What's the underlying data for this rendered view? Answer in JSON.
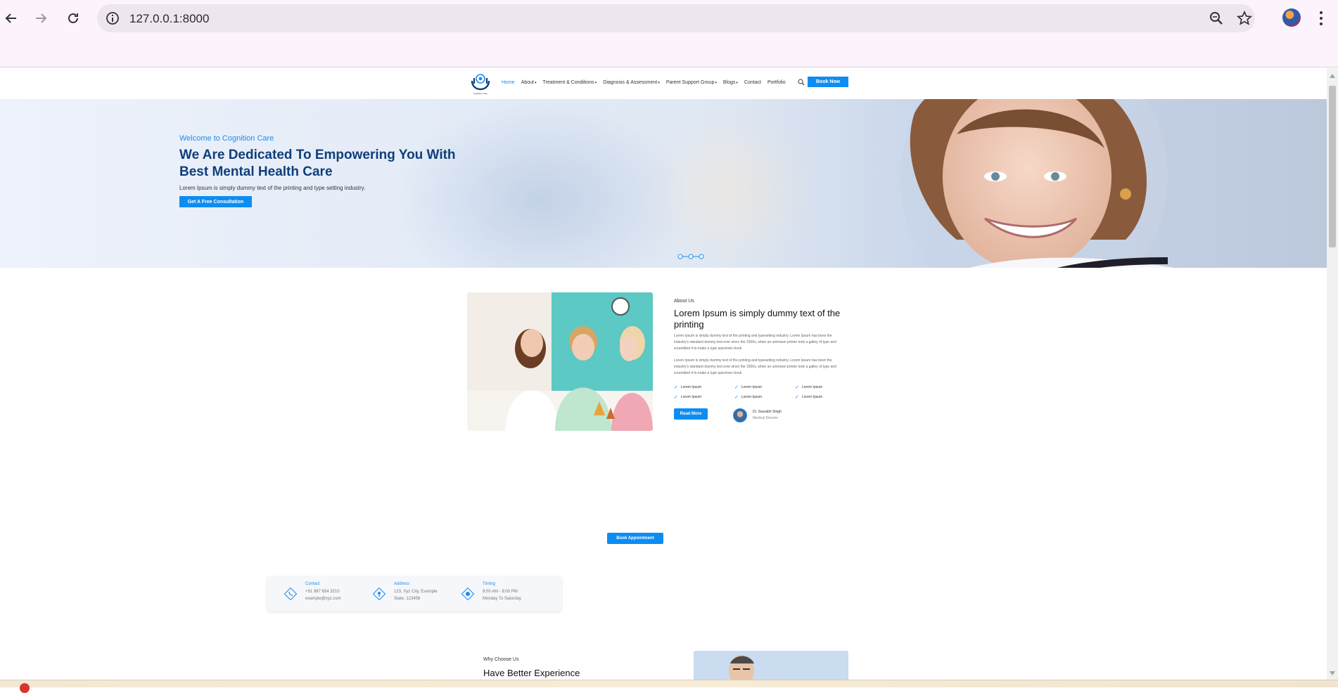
{
  "browser": {
    "url": "127.0.0.1:8000"
  },
  "nav": {
    "menu": [
      {
        "label": "Home",
        "dropdown": false,
        "active": true
      },
      {
        "label": "About",
        "dropdown": true
      },
      {
        "label": "Treatment & Conditions",
        "dropdown": true
      },
      {
        "label": "Diagnosis & Assessment",
        "dropdown": true
      },
      {
        "label": "Parent Support Group",
        "dropdown": true
      },
      {
        "label": "Blogs",
        "dropdown": true
      },
      {
        "label": "Contact",
        "dropdown": false
      },
      {
        "label": "Portfolio",
        "dropdown": false
      }
    ],
    "book_now": "Book Now",
    "logo_tagline": "Cognition Care"
  },
  "hero": {
    "welcome": "Welcome to Cognition Care",
    "title": "We Are Dedicated To Empowering You With Best Mental Health Care",
    "lead": "Lorem Ipsum is simply dummy text of the printing and type setting industry.",
    "cta": "Get A Free Consultation"
  },
  "about": {
    "eyebrow": "About Us",
    "title": "Lorem Ipsum is simply dummy text of the printing",
    "p1": "Lorem Ipsum is simply dummy text of the printing and typesetting industry. Lorem Ipsum has been the industry's standard dummy text ever since the 1500s, when an unknown printer took a galley of type and scrambled it to make a type specimen book.",
    "p2": "Lorem Ipsum is simply dummy text of the printing and typesetting industry. Lorem Ipsum has been the industry's standard dummy text ever since the 1500s, when an unknown printer took a galley of type and scrambled it to make a type specimen book.",
    "checks": [
      "Lorem Ipsum",
      "Lorem Ipsum",
      "Lorem Ipsum",
      "Lorem Ipsum",
      "Lorem Ipsum",
      "Lorem Ipsum"
    ],
    "read_more": "Read More",
    "doctor_name": "Dr. Saurabh Singh",
    "doctor_role": "Medical Director"
  },
  "appointment": {
    "button": "Book Appointment"
  },
  "contact_card": {
    "contact": {
      "label": "Contact",
      "line1": "+91 987 654 3210",
      "line2": "example@xyz.com"
    },
    "address": {
      "label": "Address",
      "line1": "123, Xyz City, Example",
      "line2": "State, 123456"
    },
    "timing": {
      "label": "Timing",
      "line1": "9:00 AM - 8:00 PM",
      "line2": "Monday To Saturday"
    }
  },
  "why": {
    "eyebrow": "Why Choose Us",
    "title": "Have Better Experience"
  },
  "colors": {
    "accent": "#0d8df2",
    "hero_title": "#0f3e7b",
    "browser_chrome": "#fdf3fd"
  }
}
